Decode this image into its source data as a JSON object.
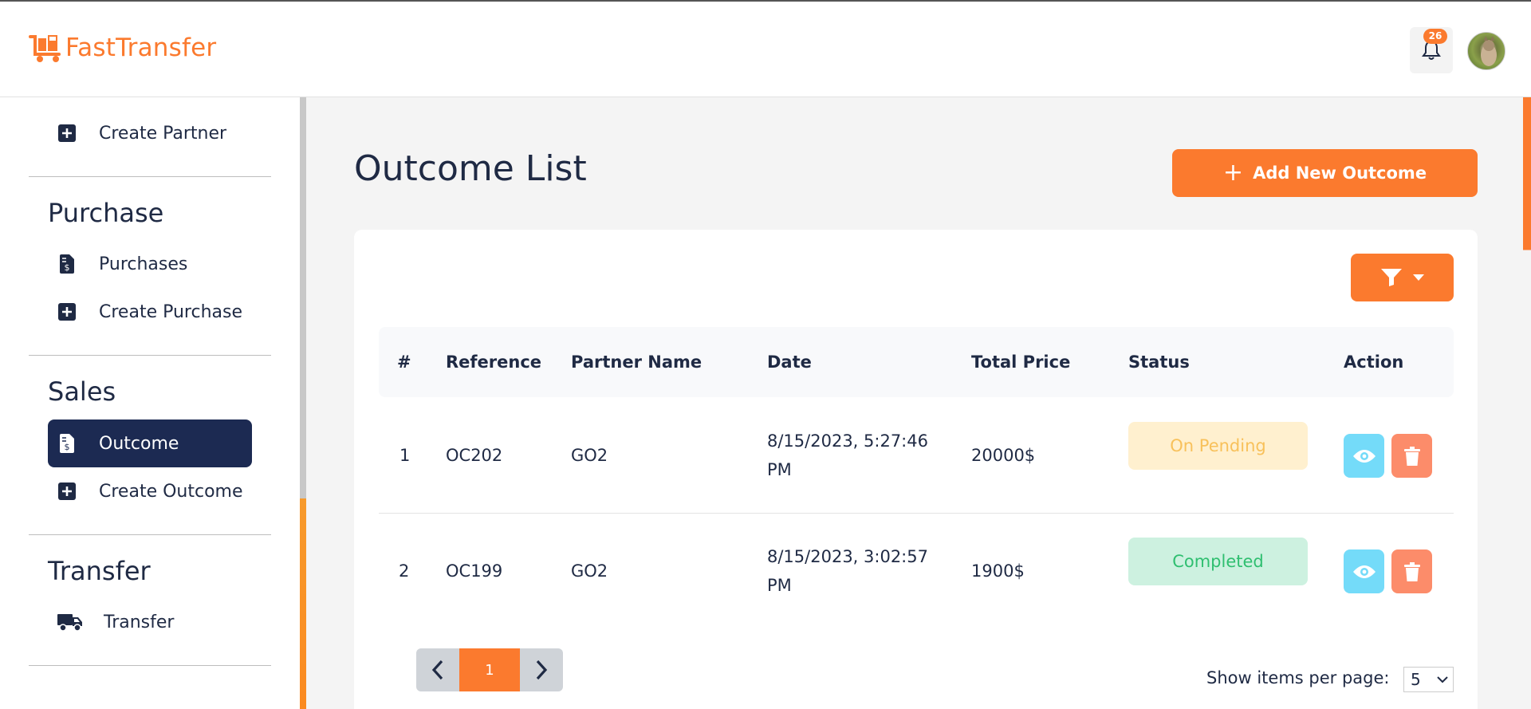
{
  "app": {
    "name": "FastTransfer",
    "notification_count": "26"
  },
  "sidebar": {
    "items_top": [
      {
        "label": "Create Partner",
        "icon": "plus-square-icon"
      }
    ],
    "sections": [
      {
        "heading": "Purchase",
        "items": [
          {
            "label": "Purchases",
            "icon": "invoice-dollar-icon"
          },
          {
            "label": "Create Purchase",
            "icon": "plus-square-icon"
          }
        ]
      },
      {
        "heading": "Sales",
        "items": [
          {
            "label": "Outcome",
            "icon": "invoice-dollar-icon",
            "active": true
          },
          {
            "label": "Create Outcome",
            "icon": "plus-square-icon"
          }
        ]
      },
      {
        "heading": "Transfer",
        "items": [
          {
            "label": "Transfer",
            "icon": "truck-icon"
          }
        ]
      }
    ]
  },
  "main": {
    "title": "Outcome List",
    "add_button_label": "Add New Outcome",
    "table": {
      "columns": [
        "#",
        "Reference",
        "Partner Name",
        "Date",
        "Total Price",
        "Status",
        "Action"
      ],
      "rows": [
        {
          "num": "1",
          "reference": "OC202",
          "partner": "GO2",
          "date_line1": "8/15/2023, 5:27:46",
          "date_line2": "PM",
          "total": "20000$",
          "status": "On Pending"
        },
        {
          "num": "2",
          "reference": "OC199",
          "partner": "GO2",
          "date_line1": "8/15/2023, 3:02:57",
          "date_line2": "PM",
          "total": "1900$",
          "status": "Completed"
        }
      ]
    },
    "pagination": {
      "current_page": "1",
      "per_page_label": "Show items per page:",
      "per_page_value": "5"
    }
  },
  "colors": {
    "accent": "#fb7a2e",
    "nav_active": "#1c2a52",
    "pending_bg": "#fff0cf",
    "completed_bg": "#cdf1e0",
    "view_button": "#74dbf9",
    "delete_button": "#fc8c6a"
  }
}
